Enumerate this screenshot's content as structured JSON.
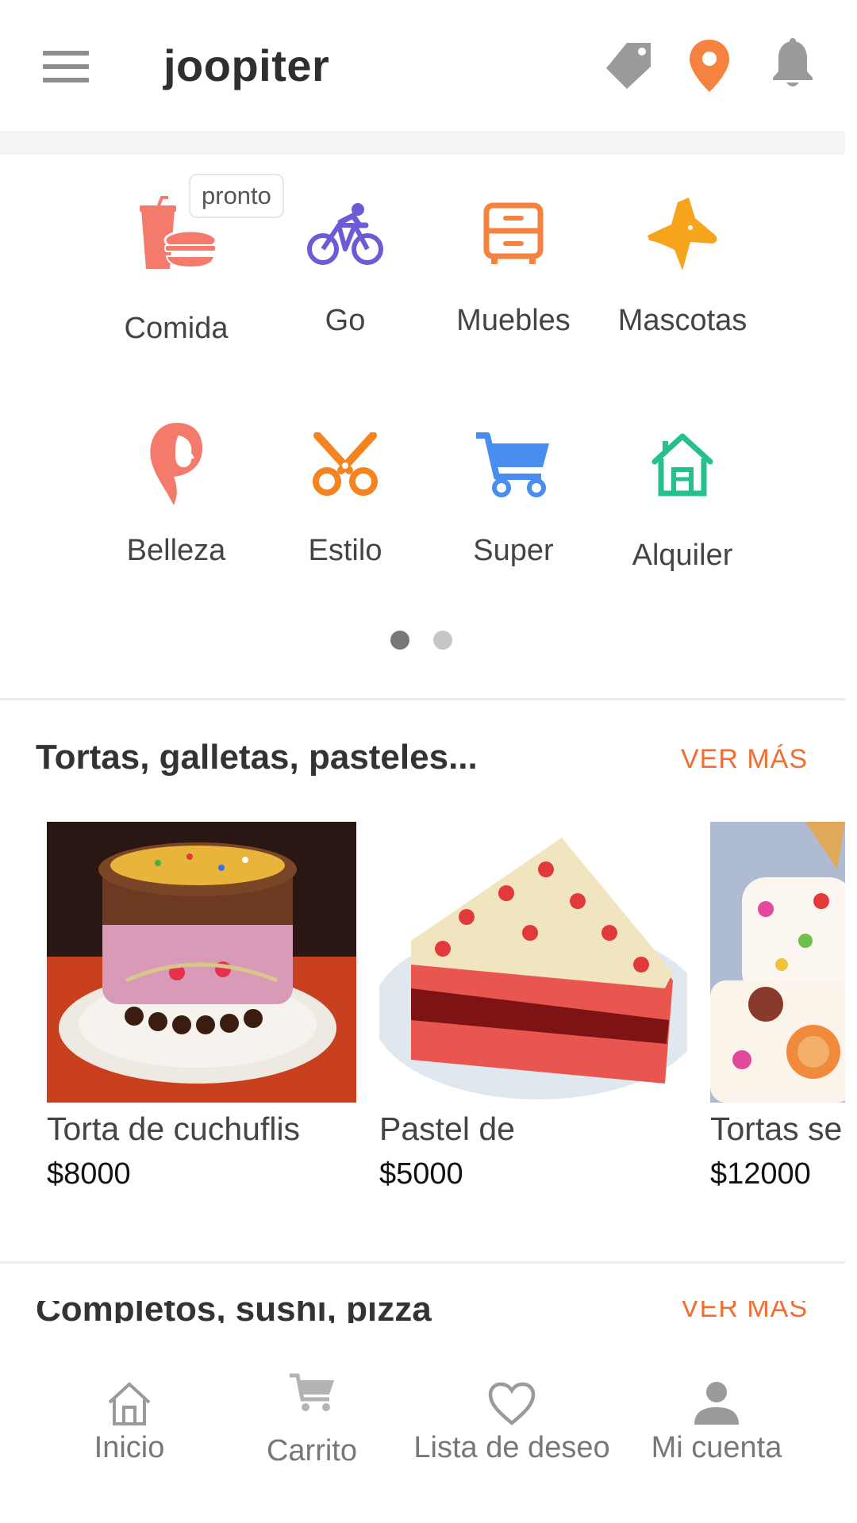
{
  "app": {
    "title": "joopiter"
  },
  "header": {
    "icons": [
      "menu-icon",
      "tag-icon",
      "location-pin-icon",
      "bell-icon"
    ]
  },
  "categories": {
    "badge": "pronto",
    "items": [
      {
        "label": "Comida",
        "icon": "fast-food-icon",
        "color": "#f47a6c"
      },
      {
        "label": "Go",
        "icon": "bicycle-icon",
        "color": "#6c5bd6"
      },
      {
        "label": "Muebles",
        "icon": "drawers-icon",
        "color": "#f5833f"
      },
      {
        "label": "Mascotas",
        "icon": "dog-icon",
        "color": "#f7a41d"
      },
      {
        "label": "Belleza",
        "icon": "woman-face-icon",
        "color": "#f47a6c"
      },
      {
        "label": "Estilo",
        "icon": "scissors-icon",
        "color": "#f5831f"
      },
      {
        "label": "Super",
        "icon": "cart-icon",
        "color": "#4a8df0"
      },
      {
        "label": "Alquiler",
        "icon": "house-icon",
        "color": "#27c08d"
      }
    ],
    "pager": {
      "pages": 2,
      "current": 1
    }
  },
  "section1": {
    "title": "Tortas, galletas, pasteles...",
    "see_more": "VER MÁS",
    "products": [
      {
        "name": "Torta de cuchuflis",
        "price": "$8000"
      },
      {
        "name": "Pastel de",
        "price": "$5000"
      },
      {
        "name": "Tortas se",
        "price": "$12000"
      }
    ]
  },
  "section2": {
    "title": "Completos, sushi, pizza",
    "see_more": "VER MÁS"
  },
  "bottom_nav": [
    {
      "label": "Inicio",
      "icon": "home-icon"
    },
    {
      "label": "Carrito",
      "icon": "cart-icon"
    },
    {
      "label": "Lista de deseo",
      "icon": "heart-icon"
    },
    {
      "label": "Mi cuenta",
      "icon": "user-icon"
    }
  ],
  "colors": {
    "accent": "#f26d32",
    "text": "#333333",
    "muted": "#777777"
  }
}
